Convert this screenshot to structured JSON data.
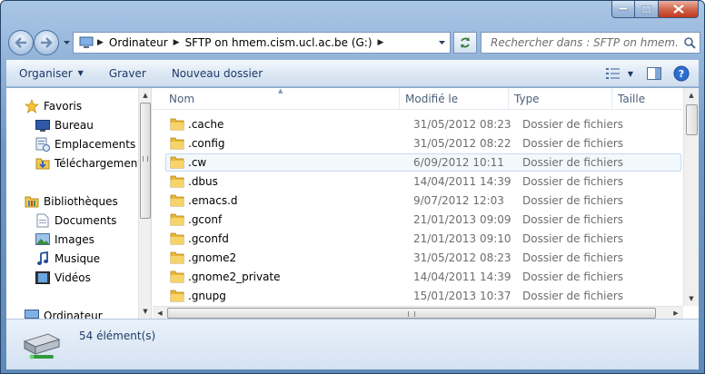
{
  "window": {
    "controls": {
      "minimize": "—",
      "maximize": "□",
      "close": "✕"
    }
  },
  "address": {
    "segments": [
      "Ordinateur",
      "SFTP on hmem.cism.ucl.ac.be (G:)"
    ]
  },
  "search": {
    "placeholder": "Rechercher dans : SFTP on hmem.cism.ucl.ac.be"
  },
  "toolbar": {
    "organize": "Organiser",
    "burn": "Graver",
    "new_folder": "Nouveau dossier"
  },
  "nav": {
    "favorites": "Favoris",
    "desktop": "Bureau",
    "recent": "Emplacements récents",
    "downloads": "Téléchargements",
    "libraries": "Bibliothèques",
    "documents": "Documents",
    "images": "Images",
    "music": "Musique",
    "videos": "Vidéos",
    "computer": "Ordinateur"
  },
  "columns": {
    "name": "Nom",
    "modified": "Modifié le",
    "type": "Type",
    "size": "Taille"
  },
  "files": [
    {
      "name": ".cache",
      "modified": "31/05/2012 08:23",
      "type": "Dossier de fichiers"
    },
    {
      "name": ".config",
      "modified": "31/05/2012 08:22",
      "type": "Dossier de fichiers"
    },
    {
      "name": ".cw",
      "modified": "6/09/2012 10:11",
      "type": "Dossier de fichiers"
    },
    {
      "name": ".dbus",
      "modified": "14/04/2011 14:39",
      "type": "Dossier de fichiers"
    },
    {
      "name": ".emacs.d",
      "modified": "9/07/2012 12:03",
      "type": "Dossier de fichiers"
    },
    {
      "name": ".gconf",
      "modified": "21/01/2013 09:09",
      "type": "Dossier de fichiers"
    },
    {
      "name": ".gconfd",
      "modified": "21/01/2013 09:10",
      "type": "Dossier de fichiers"
    },
    {
      "name": ".gnome2",
      "modified": "31/05/2012 08:23",
      "type": "Dossier de fichiers"
    },
    {
      "name": ".gnome2_private",
      "modified": "14/04/2011 14:39",
      "type": "Dossier de fichiers"
    },
    {
      "name": ".gnupg",
      "modified": "15/01/2013 10:37",
      "type": "Dossier de fichiers"
    }
  ],
  "status": {
    "count": "54 élément(s)"
  }
}
